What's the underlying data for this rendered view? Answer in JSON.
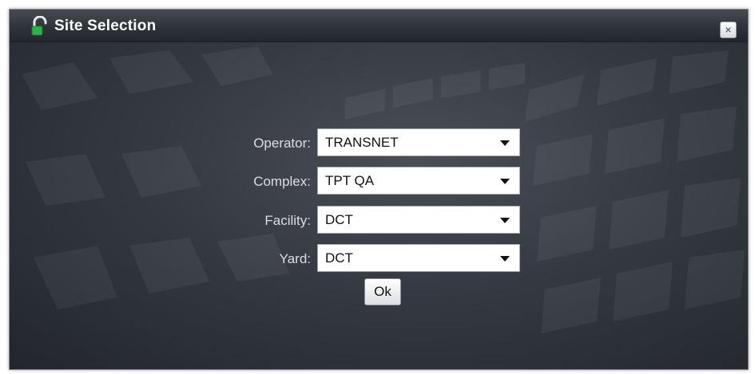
{
  "window": {
    "title": "Site Selection",
    "icon": "padlock-icon",
    "close_label": "×"
  },
  "form": {
    "fields": [
      {
        "label": "Operator:",
        "value": "TRANSNET"
      },
      {
        "label": "Complex:",
        "value": "TPT QA"
      },
      {
        "label": "Facility:",
        "value": "DCT"
      },
      {
        "label": "Yard:",
        "value": "DCT"
      }
    ],
    "ok_label": "Ok"
  },
  "colors": {
    "background": "#2b3038",
    "title_text": "#ffffff",
    "label_text": "#dcdde0",
    "lock_icon": "#28b446"
  }
}
